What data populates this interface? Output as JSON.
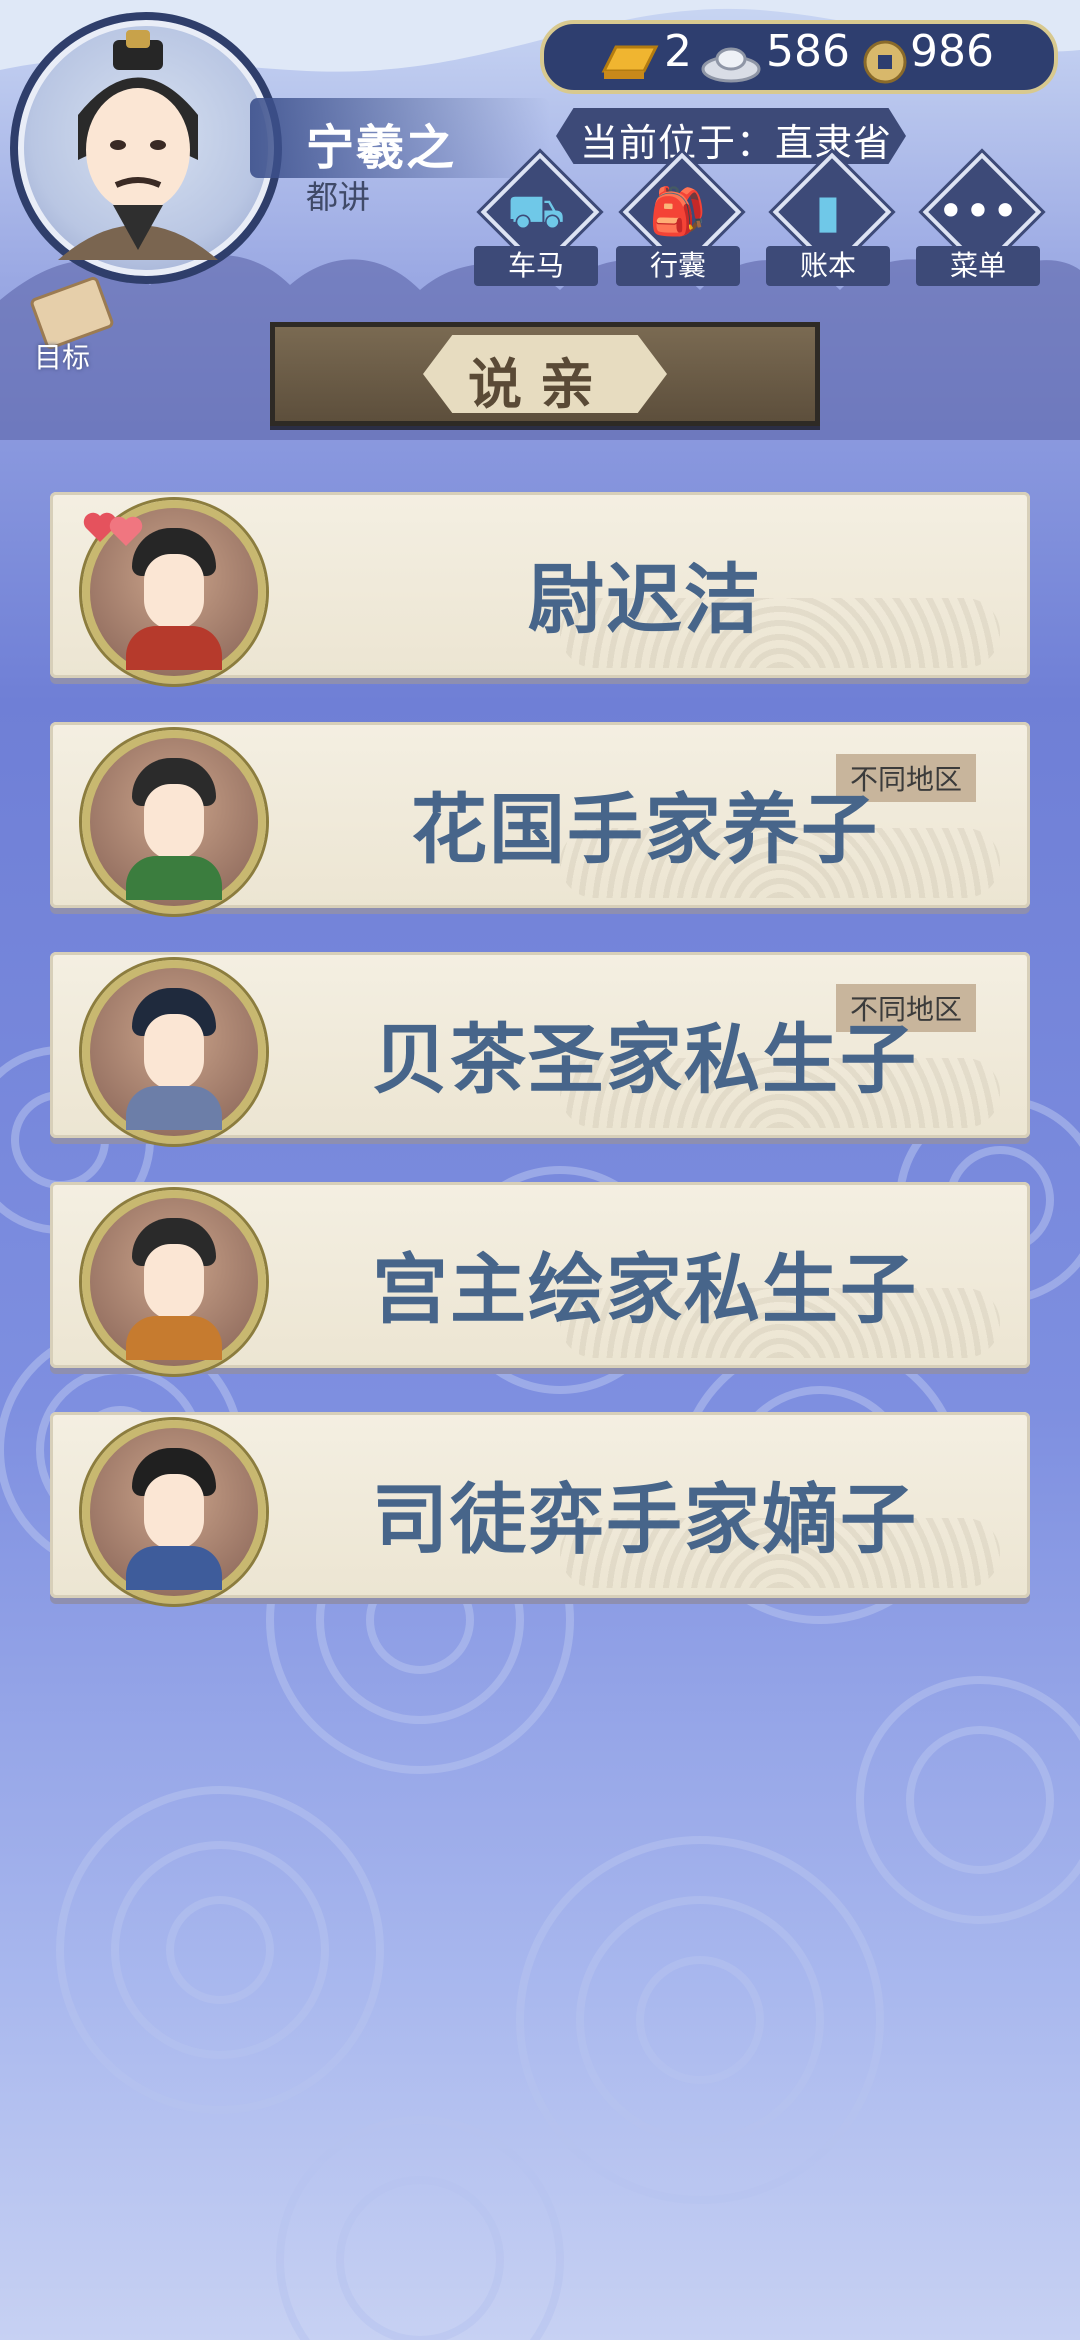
{
  "player": {
    "name": "宁羲之",
    "title": "都讲"
  },
  "currency": {
    "gold": "2",
    "silver": "586",
    "copper": "986"
  },
  "location": {
    "text": "当前位于：直隶省"
  },
  "menu": [
    {
      "label": "车马",
      "icon": "carriage-icon"
    },
    {
      "label": "行囊",
      "icon": "bag-icon"
    },
    {
      "label": "账本",
      "icon": "ledger-icon"
    },
    {
      "label": "菜单",
      "icon": "menu-dots-icon"
    }
  ],
  "goal": {
    "label": "目标"
  },
  "page": {
    "title": "说亲"
  },
  "candidates": [
    {
      "name": "尉迟洁",
      "badge": "",
      "hearts": true,
      "hair": "#262626",
      "outfit": "#b63a2c"
    },
    {
      "name": "花国手家养子",
      "badge": "不同地区",
      "hearts": false,
      "hair": "#2b2b2b",
      "outfit": "#3b7d3e"
    },
    {
      "name": "贝茶圣家私生子",
      "badge": "不同地区",
      "hearts": false,
      "hair": "#1f2a3d",
      "outfit": "#6c7ea8"
    },
    {
      "name": "宫主绘家私生子",
      "badge": "",
      "hearts": false,
      "hair": "#2a2a2a",
      "outfit": "#c67b2f"
    },
    {
      "name": "司徒弈手家嫡子",
      "badge": "",
      "hearts": false,
      "hair": "#202020",
      "outfit": "#3e5c9b"
    }
  ]
}
